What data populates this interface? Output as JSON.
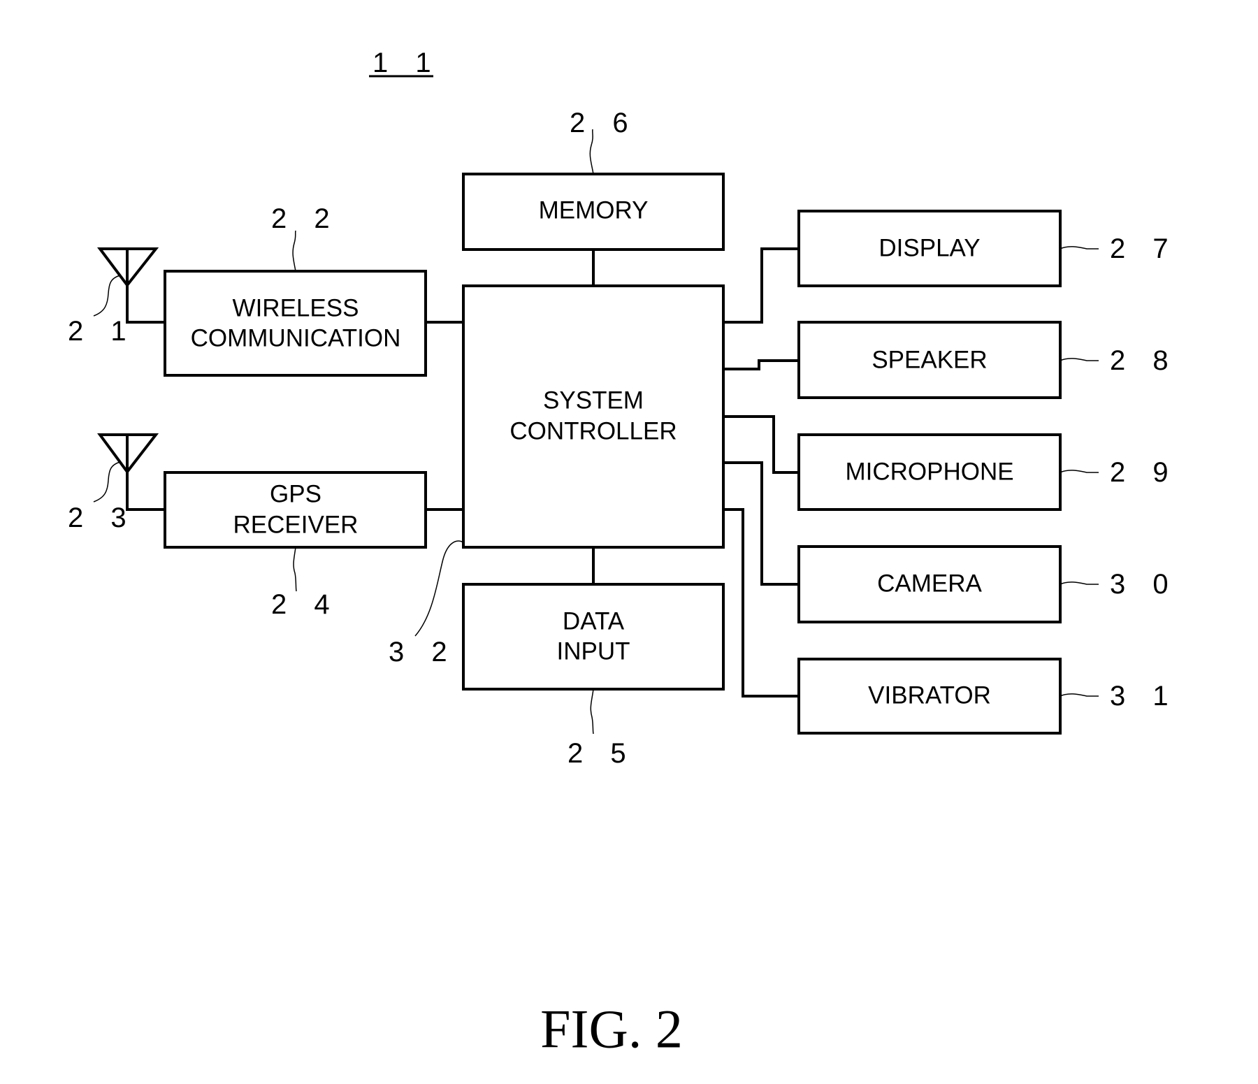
{
  "figure": {
    "label": "FIG. 2",
    "device_ref": "1 1"
  },
  "blocks": {
    "wireless": {
      "lines": [
        "WIRELESS",
        "COMMUNICATION"
      ],
      "ref": "2 2"
    },
    "gps": {
      "lines": [
        "GPS",
        "RECEIVER"
      ],
      "ref": "2 4"
    },
    "memory": {
      "lines": [
        "MEMORY"
      ],
      "ref": "2 6"
    },
    "controller": {
      "lines": [
        "SYSTEM",
        "CONTROLLER"
      ],
      "ref": "3 2"
    },
    "data_input": {
      "lines": [
        "DATA",
        "INPUT"
      ],
      "ref": "2 5"
    },
    "display": {
      "lines": [
        "DISPLAY"
      ],
      "ref": "2 7"
    },
    "speaker": {
      "lines": [
        "SPEAKER"
      ],
      "ref": "2 8"
    },
    "microphone": {
      "lines": [
        "MICROPHONE"
      ],
      "ref": "2 9"
    },
    "camera": {
      "lines": [
        "CAMERA"
      ],
      "ref": "3 0"
    },
    "vibrator": {
      "lines": [
        "VIBRATOR"
      ],
      "ref": "3 1"
    }
  },
  "antennas": {
    "wireless_antenna": {
      "ref": "2 1"
    },
    "gps_antenna": {
      "ref": "2 3"
    }
  },
  "connections": [
    [
      "wireless_antenna",
      "wireless"
    ],
    [
      "gps_antenna",
      "gps"
    ],
    [
      "wireless",
      "controller"
    ],
    [
      "gps",
      "controller"
    ],
    [
      "memory",
      "controller"
    ],
    [
      "controller",
      "data_input"
    ],
    [
      "controller",
      "display"
    ],
    [
      "controller",
      "speaker"
    ],
    [
      "controller",
      "microphone"
    ],
    [
      "controller",
      "camera"
    ],
    [
      "controller",
      "vibrator"
    ]
  ]
}
